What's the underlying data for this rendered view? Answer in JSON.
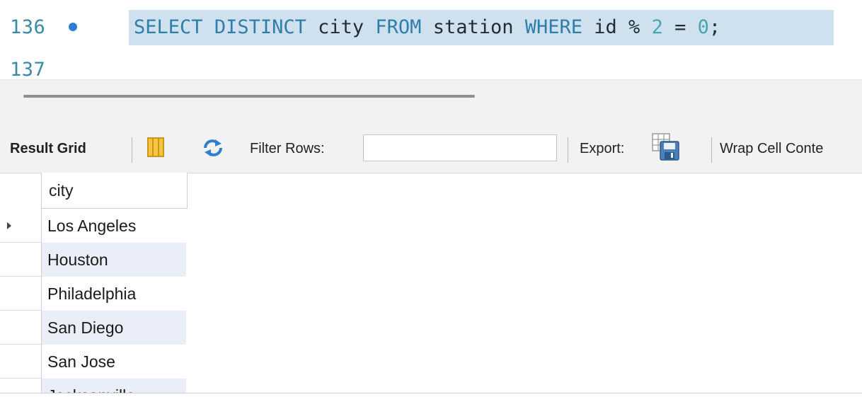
{
  "editor": {
    "lines": [
      {
        "number": "136",
        "has_breakpoint": true,
        "tokens": {
          "t1": "SELECT",
          "t2": " ",
          "t3": "DISTINCT",
          "t4": " city ",
          "t5": "FROM",
          "t6": " station ",
          "t7": "WHERE",
          "t8": " id % ",
          "t9": "2",
          "t10": " = ",
          "t11": "0",
          "t12": ";"
        }
      },
      {
        "number": "137"
      }
    ]
  },
  "toolbar": {
    "result_grid_label": "Result Grid",
    "filter_rows_label": "Filter Rows:",
    "filter_value": "",
    "export_label": "Export:",
    "wrap_cell_label": "Wrap Cell Conte"
  },
  "grid": {
    "columns": [
      "city"
    ],
    "rows": [
      {
        "city": "Los Angeles",
        "current": true
      },
      {
        "city": "Houston"
      },
      {
        "city": "Philadelphia"
      },
      {
        "city": "San Diego"
      },
      {
        "city": "San Jose"
      },
      {
        "city": "Jacksonville"
      }
    ]
  },
  "colors": {
    "keyword": "#2d7fa9",
    "line_number": "#3a8aa8",
    "selection": "#cfe0ef",
    "alt_row": "#e9eef8",
    "breakpoint": "#2a7fd1"
  },
  "icons": [
    "breakpoint-dot-icon",
    "grid-layout-icon",
    "refresh-icon",
    "export-icon",
    "row-pointer-icon"
  ]
}
